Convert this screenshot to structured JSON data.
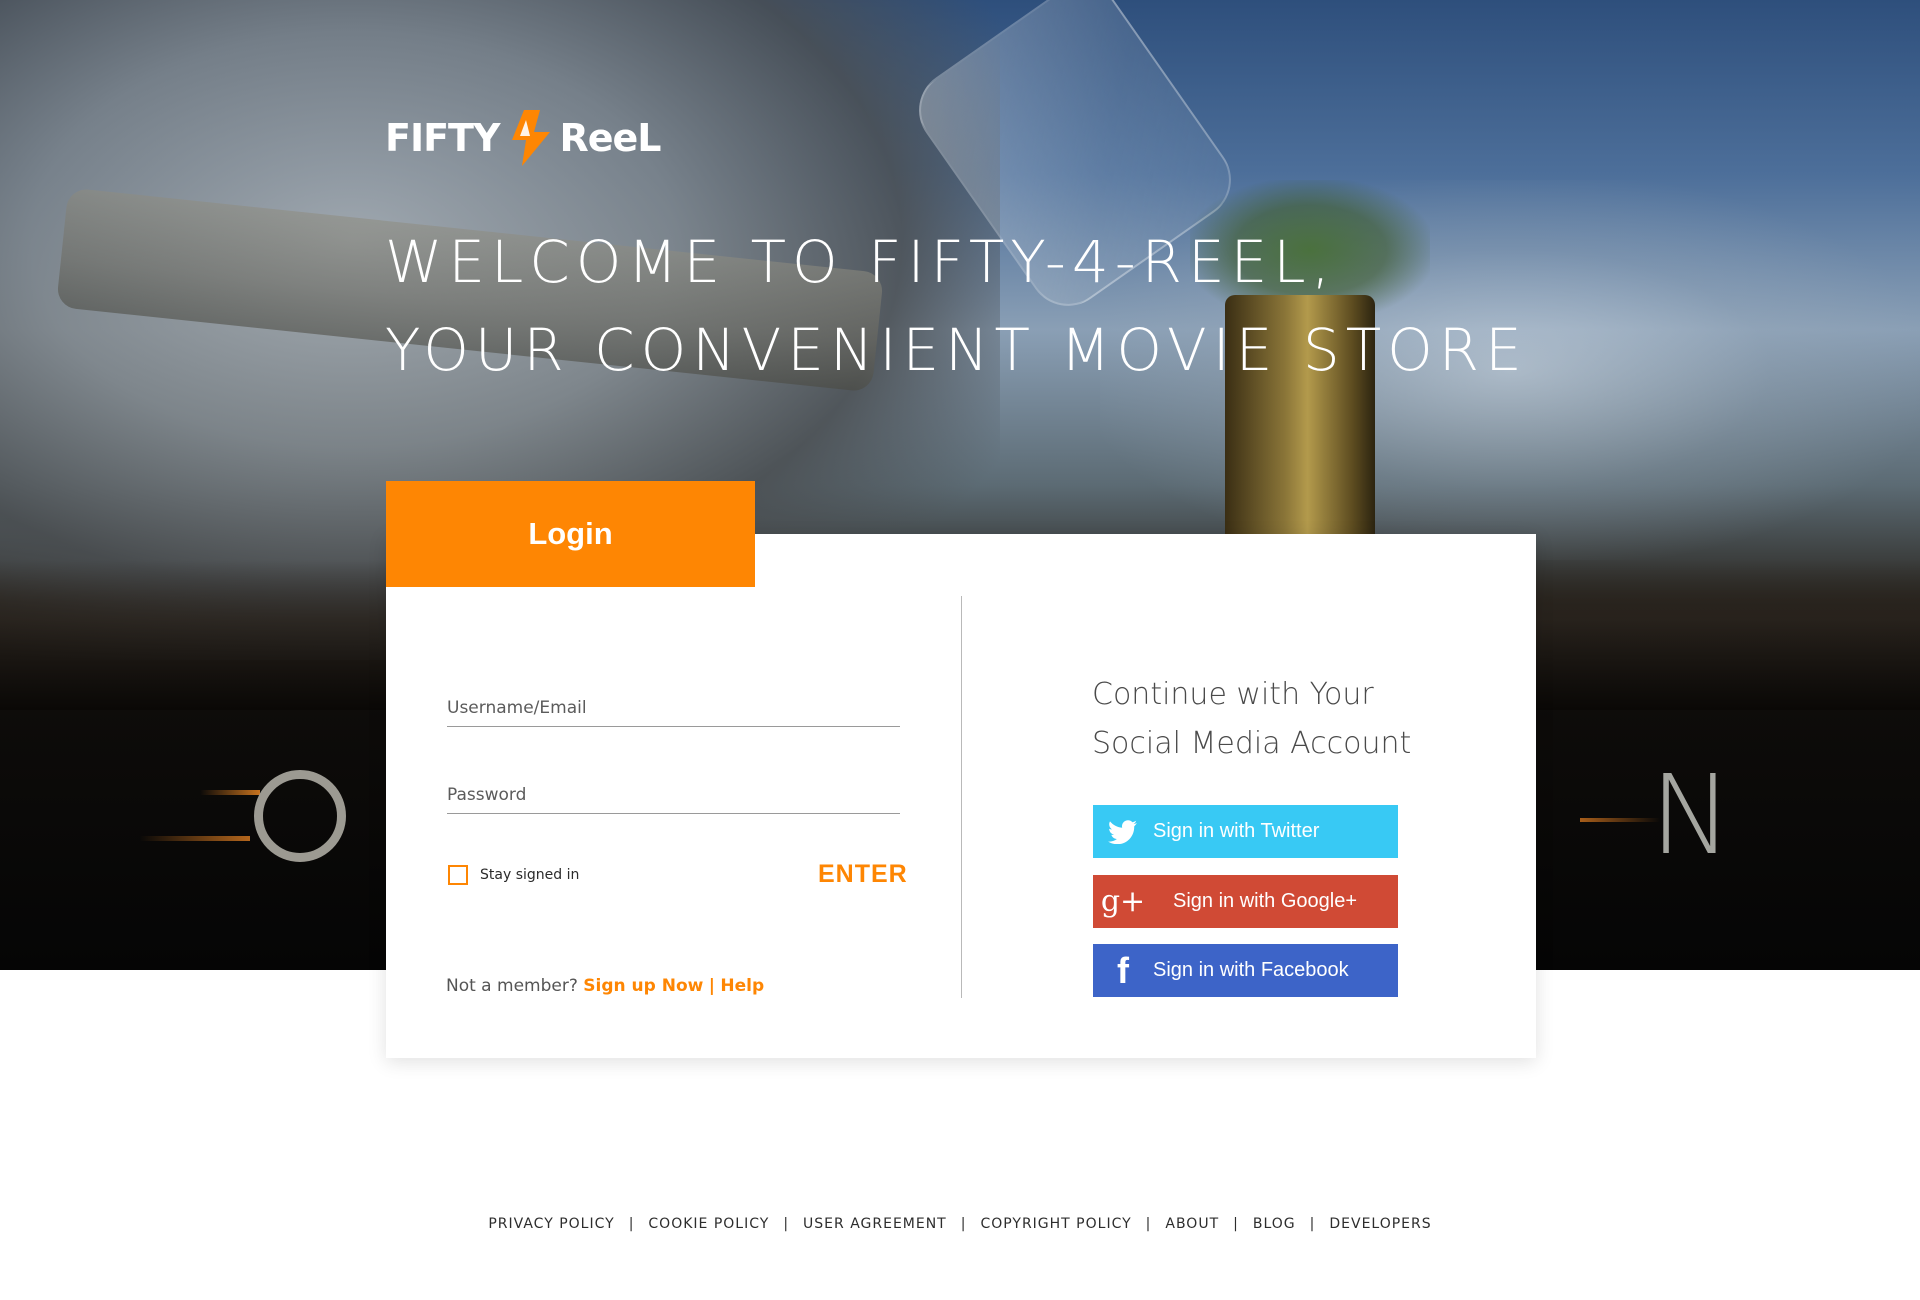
{
  "brand": {
    "name_left": "FIFTY",
    "name_right": "ReeL",
    "accent_color": "#fe8603"
  },
  "headline": {
    "line1": "WELCOME TO FIFTY-4-REEL,",
    "line2": "YOUR CONVENIENT MOVIE STORE"
  },
  "hero": {
    "letter_left": "O",
    "letter_right": "N"
  },
  "login": {
    "tab_label": "Login",
    "username_placeholder": "Username/Email",
    "password_placeholder": "Password",
    "stay_signed_in_label": "Stay signed in",
    "enter_label": "ENTER",
    "not_member_text": "Not a member?",
    "signup_link": "Sign up Now",
    "separator": "|",
    "help_link": "Help"
  },
  "social": {
    "heading_line1": "Continue with Your",
    "heading_line2": "Social Media Account",
    "twitter": {
      "label": "Sign in with Twitter",
      "icon": "twitter-bird-icon",
      "color": "#38c9f4"
    },
    "google": {
      "label": "Sign in with Google+",
      "icon": "google-plus-icon",
      "icon_text": "g+",
      "color": "#d04a35"
    },
    "facebook": {
      "label": "Sign in with Facebook",
      "icon": "facebook-f-icon",
      "icon_text": "f",
      "color": "#3d64c8"
    }
  },
  "footer": {
    "links": [
      "PRIVACY POLICY",
      "COOKIE POLICY",
      "USER AGREEMENT",
      "COPYRIGHT POLICY",
      "ABOUT",
      "BLOG",
      "DEVELOPERS"
    ],
    "separator": "|"
  }
}
